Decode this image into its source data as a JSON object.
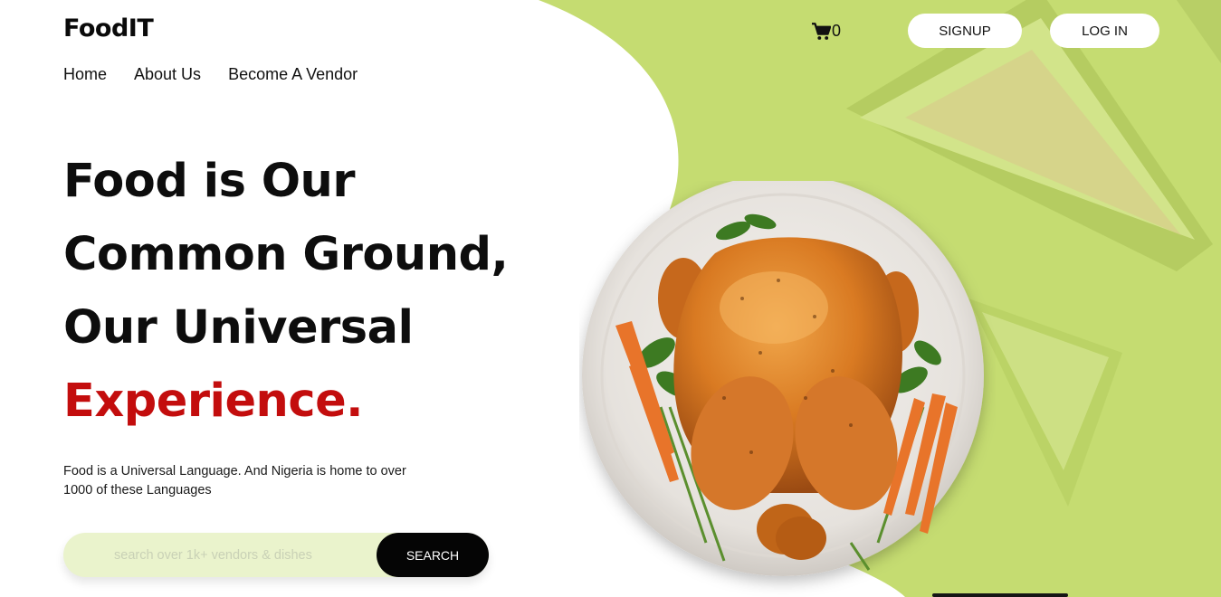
{
  "brand": {
    "logo_text": "FoodIT"
  },
  "nav": {
    "items": [
      "Home",
      "About Us",
      "Become A Vendor"
    ]
  },
  "header": {
    "cart_count": "0",
    "signup_label": "SIGNUP",
    "login_label": "LOG IN"
  },
  "hero": {
    "line1": "Food is Our",
    "line2": "Common Ground,",
    "line3": "Our Universal",
    "line4": "Experience.",
    "subtext": "Food is a Universal Language. And Nigeria is home to over 1000 of these Languages"
  },
  "search": {
    "placeholder": "search over 1k+ vendors & dishes",
    "button_label": "SEARCH"
  },
  "icons": {
    "cart": "cart-icon"
  },
  "colors": {
    "accent_red": "#c30d0d",
    "background_green": "#c5dc71",
    "search_field_bg": "#eaf3cc",
    "button_dark": "#050505"
  }
}
